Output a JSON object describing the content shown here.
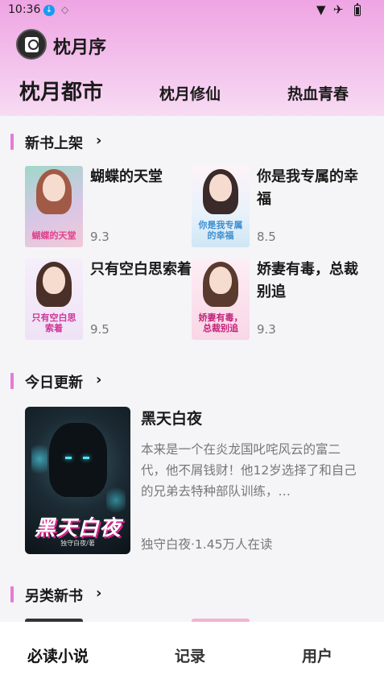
{
  "status_bar": {
    "time": "10:36",
    "icons": [
      "download-icon",
      "cube-icon",
      "wifi-icon",
      "airplane-icon",
      "battery-icon"
    ]
  },
  "app": {
    "title": "枕月序",
    "logo": "app-logo"
  },
  "top_tabs": [
    {
      "label": "枕月都市",
      "active": true
    },
    {
      "label": "枕月修仙",
      "active": false
    },
    {
      "label": "热血青春",
      "active": false
    }
  ],
  "sections": {
    "new_books": {
      "title": "新书上架",
      "books": [
        {
          "name": "蝴蝶的天堂",
          "score": "9.3",
          "cover_text": "蝴蝶的天堂"
        },
        {
          "name": "你是我专属的幸福",
          "score": "8.5",
          "cover_text": "你是我专属的幸福"
        },
        {
          "name": "只有空白思索着",
          "score": "9.5",
          "cover_text": "只有空白思索着"
        },
        {
          "name": "娇妻有毒，总裁别追",
          "score": "9.3",
          "cover_text": "娇妻有毒，总裁别追"
        }
      ]
    },
    "today_update": {
      "title": "今日更新",
      "book": {
        "name": "黑天白夜",
        "cover_text": "黑天白夜",
        "desc": "本来是一个在炎龙国叱咤风云的富二代，他不屑钱财！他12岁选择了和自己的兄弟去特种部队训练，…",
        "meta": "独守白夜·1.45万人在读"
      }
    },
    "other_new": {
      "title": "另类新书"
    }
  },
  "bottom_nav": [
    {
      "label": "必读小说",
      "active": true
    },
    {
      "label": "记录",
      "active": false
    },
    {
      "label": "用户",
      "active": false
    }
  ],
  "colors": {
    "accent": "#e47bd8",
    "header_top": "#efa4e3",
    "header_bottom": "#f7dbf3"
  }
}
